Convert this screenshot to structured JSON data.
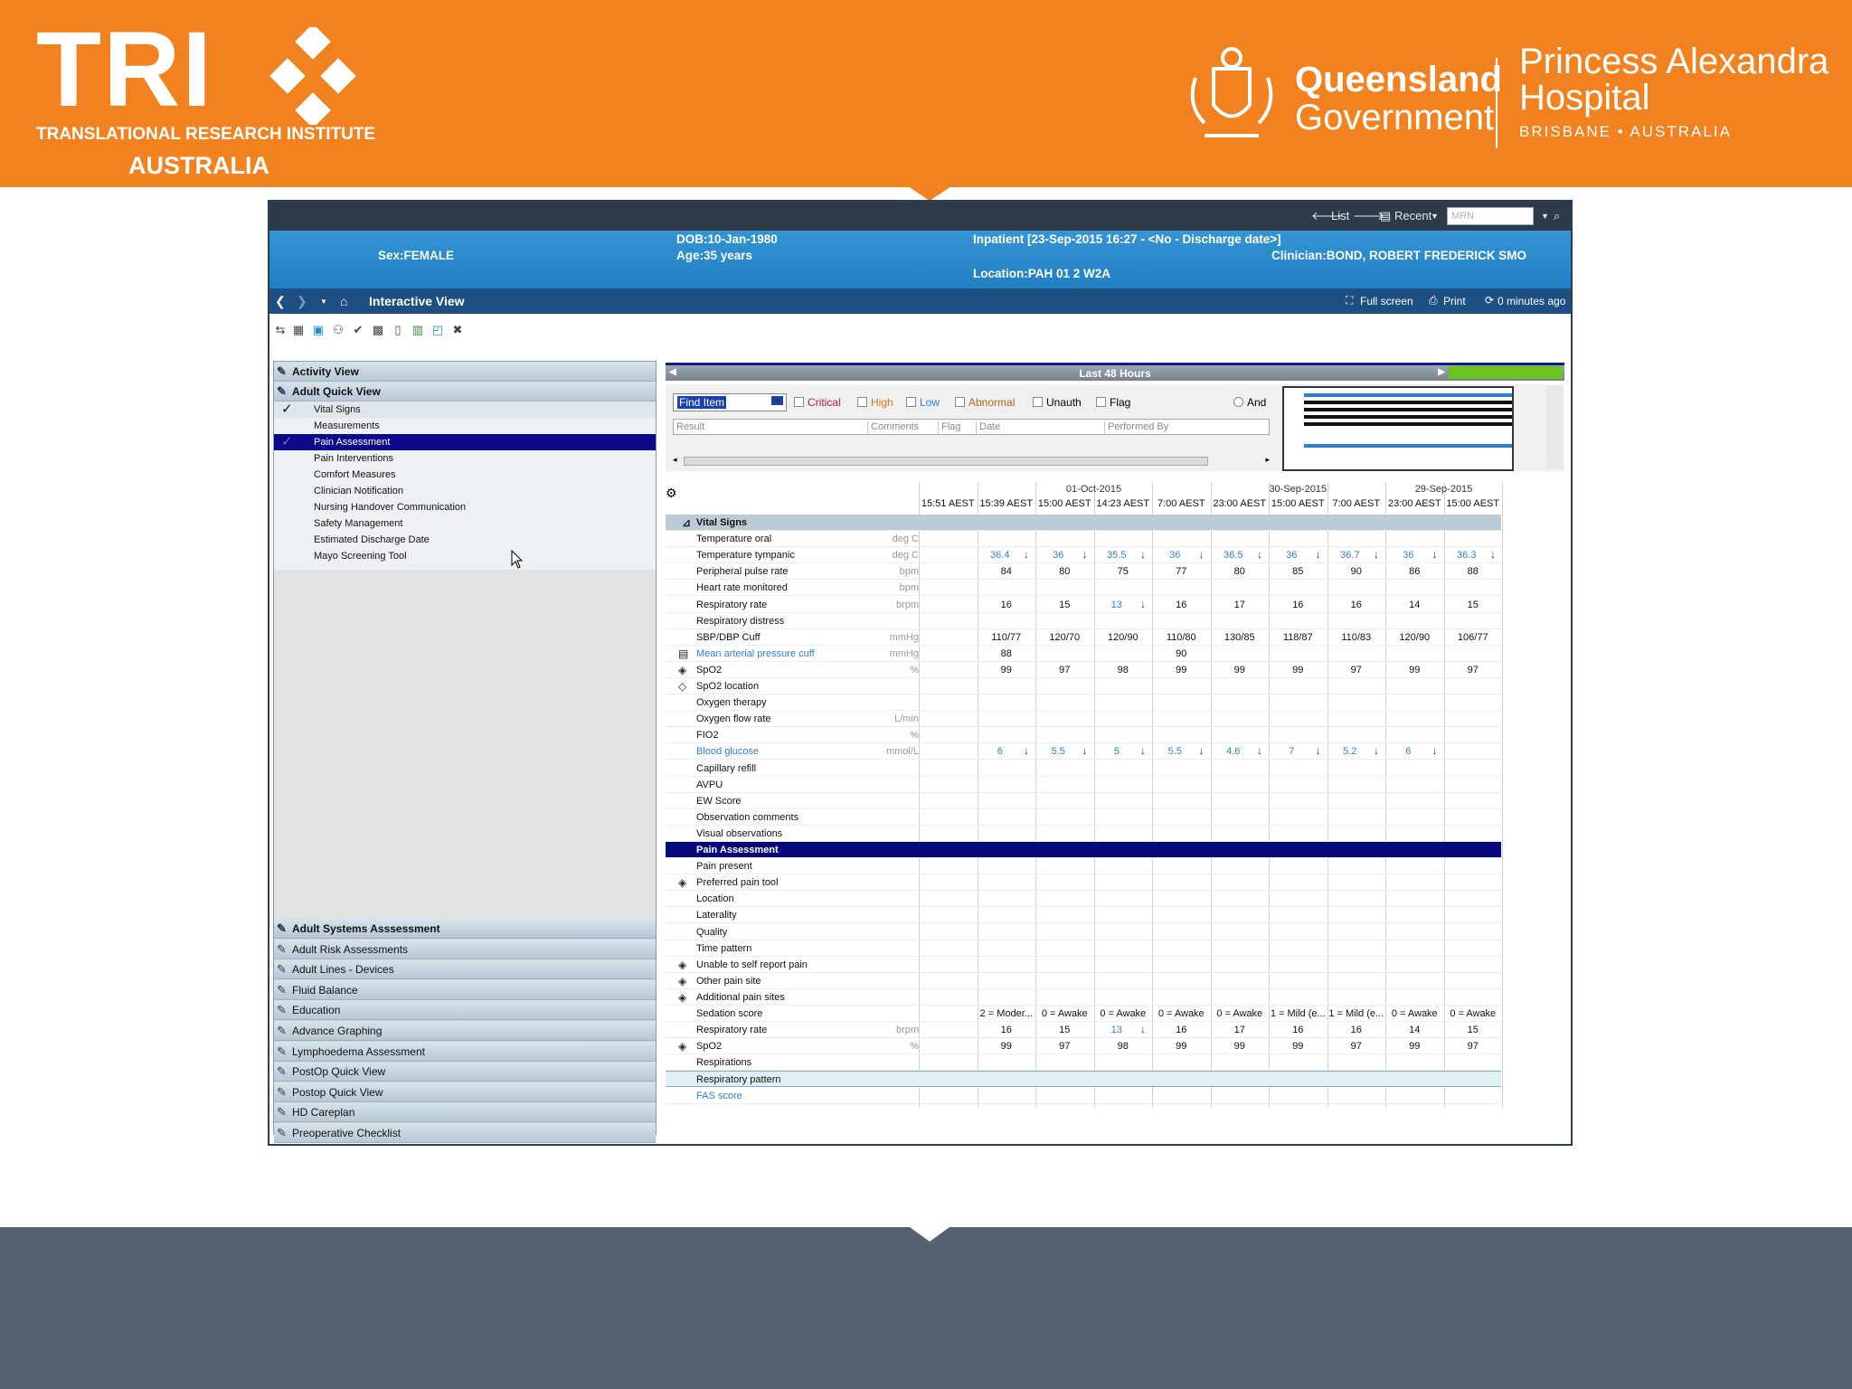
{
  "slide": {
    "tri": {
      "word": "TRI",
      "sub1": "TRANSLATIONAL RESEARCH INSTITUTE",
      "sub2": "AUSTRALIA"
    },
    "qld": {
      "name1": "Queensland",
      "name2": "Government"
    },
    "hospital": {
      "line1": "Princess Alexandra",
      "line2": "Hospital",
      "line3": "BRISBANE • AUSTRALIA"
    },
    "colors": {
      "banner": "#f2821f",
      "footer": "#56606f"
    }
  },
  "topbar": {
    "list": "List",
    "recent": "Recent",
    "mrn_placeholder": "MRN"
  },
  "patient": {
    "sex": "Sex:FEMALE",
    "dob": "DOB:10-Jan-1980",
    "age": "Age:35 years",
    "encounter": "Inpatient [23-Sep-2015 16:27 - <No - Discharge date>]",
    "clinician": "Clinician:BOND, ROBERT FREDERICK SMO",
    "location": "Location:PAH 01 2 W2A"
  },
  "nav": {
    "title": "Interactive View",
    "fullscreen": "Full screen",
    "print": "Print",
    "refresh": "0 minutes ago"
  },
  "left": {
    "top_sections": [
      "Activity View",
      "Adult Quick View"
    ],
    "items": [
      "Vital Signs",
      "Measurements",
      "Pain Assessment",
      "Pain Interventions",
      "Comfort Measures",
      "Clinician Notification",
      "Nursing Handover Communication",
      "Safety Management",
      "Estimated Discharge Date",
      "Mayo Screening Tool"
    ],
    "bottom_sections": [
      "Adult Systems Asssessment",
      "Adult Risk Assessments",
      "Adult Lines - Devices",
      "Fluid Balance",
      "Education",
      "Advance Graphing",
      "Lymphoedema Assessment",
      "PostOp Quick View",
      "Postop Quick View",
      "HD Careplan",
      "Preoperative Checklist"
    ]
  },
  "filters": {
    "range": "Last 48 Hours",
    "find": "Find Item",
    "critical": "Critical",
    "high": "High",
    "low": "Low",
    "abnormal": "Abnormal",
    "unauth": "Unauth",
    "flag": "Flag",
    "and": "And",
    "cols": [
      "Result",
      "Comments",
      "Flag",
      "Date",
      "Performed By"
    ]
  },
  "grid": {
    "dates": [
      "01-Oct-2015",
      "30-Sep-2015",
      "29-Sep-2015"
    ],
    "times": [
      "15:51 AEST",
      "15:39 AEST",
      "15:00 AEST",
      "14:23 AEST",
      "7:00 AEST",
      "23:00 AEST",
      "15:00 AEST",
      "7:00 AEST",
      "23:00 AEST",
      "15:00 AEST"
    ],
    "rows": [
      {
        "label": "Vital Signs",
        "type": "section"
      },
      {
        "label": "Temperature oral",
        "unit": "deg C"
      },
      {
        "label": "Temperature tympanic",
        "unit": "deg C",
        "values": [
          "",
          "36.4",
          "36",
          "35.5",
          "36",
          "36.5",
          "36",
          "36.7",
          "36",
          "36.3"
        ],
        "link": true,
        "arrow": true
      },
      {
        "label": "Peripheral pulse rate",
        "unit": "bpm",
        "values": [
          "",
          "84",
          "80",
          "75",
          "77",
          "80",
          "85",
          "90",
          "86",
          "88"
        ]
      },
      {
        "label": "Heart rate monitored",
        "unit": "bpm"
      },
      {
        "label": "Respiratory rate",
        "unit": "brpm",
        "values": [
          "",
          "16",
          "15",
          "13",
          "16",
          "17",
          "16",
          "16",
          "14",
          "15"
        ],
        "special": 3
      },
      {
        "label": "Respiratory distress"
      },
      {
        "label": "SBP/DBP Cuff",
        "unit": "mmHg",
        "values": [
          "",
          "110/77",
          "120/70",
          "120/90",
          "110/80",
          "130/85",
          "118/87",
          "110/83",
          "120/90",
          "106/77"
        ]
      },
      {
        "label": "Mean arterial pressure cuff",
        "unit": "mmHg",
        "values": [
          "",
          "88",
          "",
          "",
          "90",
          "",
          "",
          "",
          "",
          ""
        ],
        "labelLink": true,
        "icon": "calc-icon"
      },
      {
        "label": "SpO2",
        "unit": "%",
        "values": [
          "",
          "99",
          "97",
          "98",
          "99",
          "99",
          "99",
          "97",
          "99",
          "97"
        ],
        "icon": "diamond-icon"
      },
      {
        "label": "SpO2 location",
        "icon": "diamond-outline-icon"
      },
      {
        "label": "Oxygen therapy"
      },
      {
        "label": "Oxygen flow rate",
        "unit": "L/min"
      },
      {
        "label": "FIO2",
        "unit": "%"
      },
      {
        "label": "Blood glucose",
        "unit": "mmol/L",
        "values": [
          "",
          "6",
          "5.5",
          "5",
          "5.5",
          "4.6",
          "7",
          "5.2",
          "6",
          ""
        ],
        "link": true,
        "arrow": true,
        "labelLink": true
      },
      {
        "label": "Capillary refill"
      },
      {
        "label": "AVPU"
      },
      {
        "label": "EW Score"
      },
      {
        "label": "Observation comments"
      },
      {
        "label": "Visual observations"
      },
      {
        "label": "Pain Assessment",
        "type": "pa"
      },
      {
        "label": "Pain present"
      },
      {
        "label": "Preferred pain tool",
        "icon": "diamond-icon"
      },
      {
        "label": "Location"
      },
      {
        "label": "Laterality"
      },
      {
        "label": "Quality"
      },
      {
        "label": "Time pattern"
      },
      {
        "label": "Unable to self report pain",
        "icon": "diamond-icon"
      },
      {
        "label": "Other pain site",
        "icon": "diamond-icon"
      },
      {
        "label": "Additional pain sites",
        "icon": "diamond-icon"
      },
      {
        "label": "Sedation score",
        "values": [
          "",
          "2 = Moder...",
          "0 = Awake",
          "0 = Awake",
          "0 = Awake",
          "0 = Awake",
          "1 = Mild (e...",
          "1 = Mild (e...",
          "0 = Awake",
          "0 = Awake"
        ]
      },
      {
        "label": "Respiratory rate",
        "unit": "brpm",
        "values": [
          "",
          "16",
          "15",
          "13",
          "16",
          "17",
          "16",
          "16",
          "14",
          "15"
        ],
        "special": 3
      },
      {
        "label": "SpO2",
        "unit": "%",
        "values": [
          "",
          "99",
          "97",
          "98",
          "99",
          "99",
          "99",
          "97",
          "99",
          "97"
        ],
        "icon": "diamond-icon"
      },
      {
        "label": "Respirations"
      },
      {
        "label": "Respiratory pattern",
        "type": "hl"
      },
      {
        "label": "FAS score",
        "labelLink": true
      }
    ]
  }
}
